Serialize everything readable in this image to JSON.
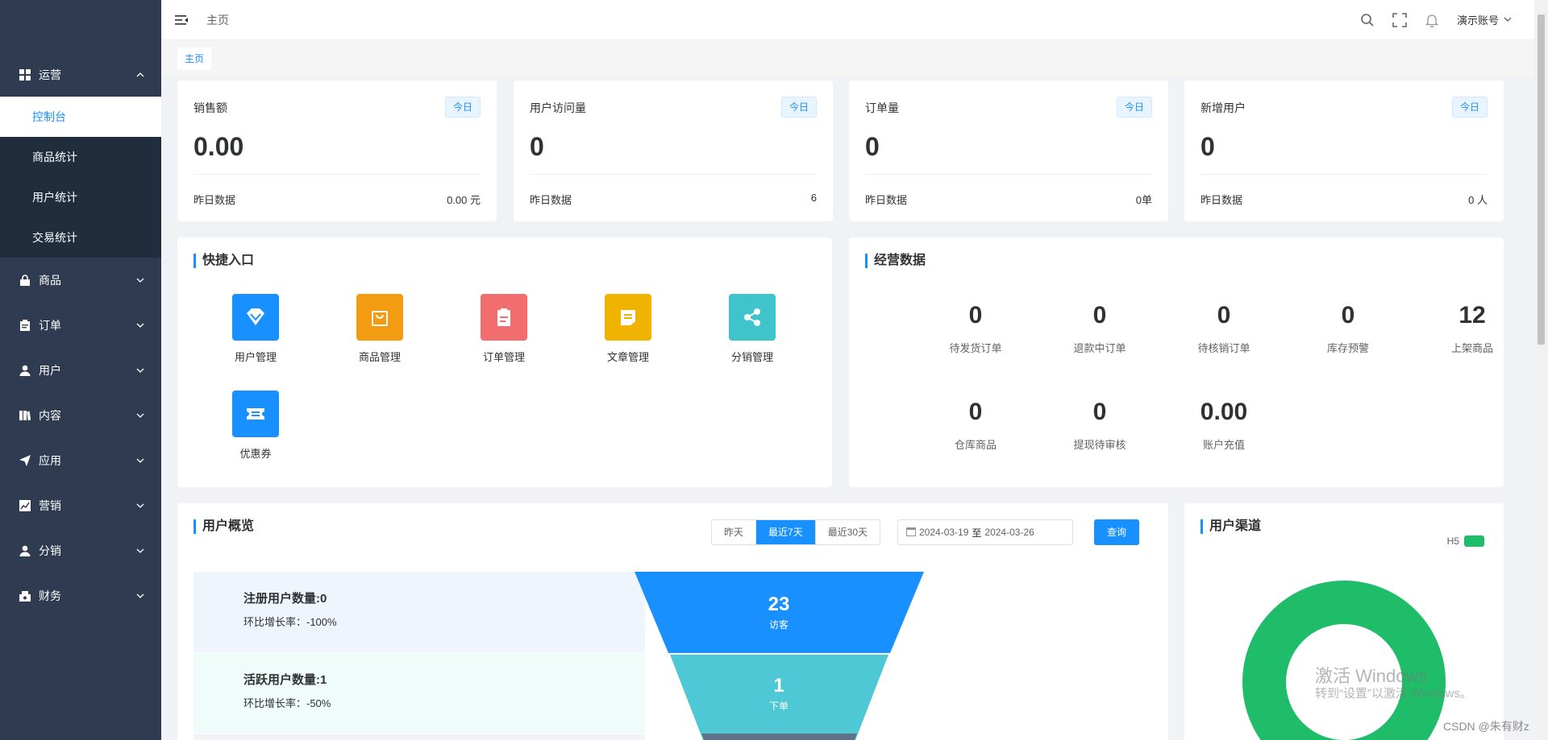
{
  "sidebar": {
    "groups": [
      {
        "label": "运营",
        "icon": "grid-icon"
      },
      {
        "label": "商品",
        "icon": "lock-icon"
      },
      {
        "label": "订单",
        "icon": "clipboard-icon"
      },
      {
        "label": "用户",
        "icon": "user-icon"
      },
      {
        "label": "内容",
        "icon": "book-icon"
      },
      {
        "label": "应用",
        "icon": "send-icon"
      },
      {
        "label": "营销",
        "icon": "chart-icon"
      },
      {
        "label": "分销",
        "icon": "user-icon"
      },
      {
        "label": "财务",
        "icon": "finance-icon"
      }
    ],
    "sub_items": [
      "控制台",
      "商品统计",
      "用户统计",
      "交易统计"
    ]
  },
  "header": {
    "breadcrumb": "主页",
    "account": "演示账号"
  },
  "tagbar": {
    "tag": "主页"
  },
  "stats": [
    {
      "title": "销售额",
      "badge": "今日",
      "value": "0.00",
      "foot_label": "昨日数据",
      "foot_value": "0.00 元"
    },
    {
      "title": "用户访问量",
      "badge": "今日",
      "value": "0",
      "foot_label": "昨日数据",
      "foot_value": "6"
    },
    {
      "title": "订单量",
      "badge": "今日",
      "value": "0",
      "foot_label": "昨日数据",
      "foot_value": "0单"
    },
    {
      "title": "新增用户",
      "badge": "今日",
      "value": "0",
      "foot_label": "昨日数据",
      "foot_value": "0 人"
    }
  ],
  "quick": {
    "title": "快捷入口",
    "items": [
      {
        "label": "用户管理",
        "color": "#1890ff",
        "icon": "diamond-icon"
      },
      {
        "label": "商品管理",
        "color": "#f39c12",
        "icon": "bag-icon"
      },
      {
        "label": "订单管理",
        "color": "#f26d6d",
        "icon": "clipboard-icon"
      },
      {
        "label": "文章管理",
        "color": "#f0b400",
        "icon": "document-icon"
      },
      {
        "label": "分销管理",
        "color": "#40c4cc",
        "icon": "share-icon"
      },
      {
        "label": "优惠券",
        "color": "#1890ff",
        "icon": "ticket-icon"
      }
    ]
  },
  "business": {
    "title": "经营数据",
    "items": [
      {
        "value": "0",
        "label": "待发货订单"
      },
      {
        "value": "0",
        "label": "退款中订单"
      },
      {
        "value": "0",
        "label": "待核销订单"
      },
      {
        "value": "0",
        "label": "库存预警"
      },
      {
        "value": "12",
        "label": "上架商品"
      },
      {
        "value": "0",
        "label": "仓库商品"
      },
      {
        "value": "0",
        "label": "提现待审核"
      },
      {
        "value": "0.00",
        "label": "账户充值"
      }
    ]
  },
  "overview": {
    "title": "用户概览",
    "ranges": [
      "昨天",
      "最近7天",
      "最近30天"
    ],
    "active_range": "最近7天",
    "date_start": "2024-03-19",
    "date_sep": "至",
    "date_end": "2024-03-26",
    "query": "查询",
    "rows": [
      {
        "title": "注册用户数量:0",
        "sub": "环比增长率：-100%",
        "bg": "#eff5fd"
      },
      {
        "title": "活跃用户数量:1",
        "sub": "环比增长率：-50%",
        "bg": "#effcf9"
      }
    ],
    "funnel": [
      {
        "num": "23",
        "label": "访客",
        "color": "#1890ff"
      },
      {
        "num": "1",
        "label": "下单",
        "color": "#4dc8d4"
      }
    ]
  },
  "channel": {
    "title": "用户渠道",
    "legend": "H5",
    "color": "#1fbd6a"
  },
  "watermark": {
    "line1": "激活 Windows",
    "line2": "转到“设置”以激活 Windows。"
  },
  "csdn": "CSDN @朱有财z"
}
